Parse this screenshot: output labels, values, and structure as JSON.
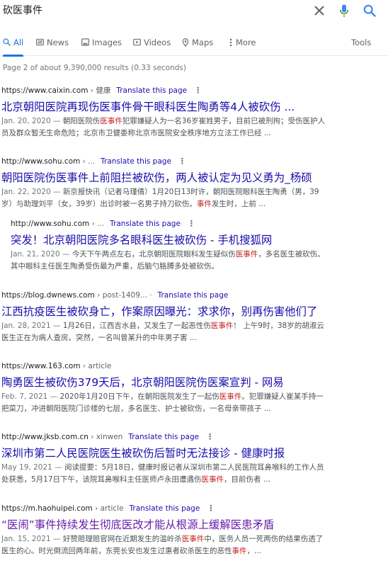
{
  "search": {
    "query": "砍医事件"
  },
  "tabs": [
    {
      "label": "All",
      "icon": "search-icon",
      "active": true
    },
    {
      "label": "News",
      "icon": "news-icon"
    },
    {
      "label": "Images",
      "icon": "image-icon"
    },
    {
      "label": "Videos",
      "icon": "video-icon"
    },
    {
      "label": "Maps",
      "icon": "map-pin-icon"
    },
    {
      "label": "More",
      "icon": "more-vertical-icon"
    }
  ],
  "tools_label": "Tools",
  "stats": "Page 2 of about 9,390,000 results (0.33 seconds)",
  "translate_label": "Translate this page",
  "results": [
    {
      "site": "https://www.caixin.com",
      "path": "健康",
      "title": "北京朝阳医院再现伤医事件骨干眼科医生陶勇等4人被砍伤 ...",
      "date": "Jan. 20, 2020",
      "line1_a": "朝阳医院伤",
      "line1_hl": "医事件",
      "line1_b": "犯罪嫌疑人为一名36岁崔姓男子，目前已被刑拘；受伤医护人",
      "line2": "员及群众暂无生命危险；北京市卫健委称北京市医院安全秩序地方立法工作已经 ..."
    },
    {
      "site": "http://www.sohu.com",
      "path": "...",
      "title": "朝阳医院伤医事件上前阻拦被砍伤，两人被认定为见义勇为_杨硕",
      "date": "Jan. 22, 2020",
      "line1": "新京报快讯（记者马瑾倩）1月20日13时许，朝阳医院眼科医生陶勇（男，39",
      "line2_a": "岁）与助理刘平（女，39岁）出诊时被一名男子持刀砍伤。",
      "line2_hl": "事件",
      "line2_b": "发生时，上前 ..."
    },
    {
      "site": "http://www.sohu.com",
      "path": "...",
      "title": "突发！北京朝阳医院多名眼科医生被砍伤 - 手机搜狐网",
      "date": "Jan. 21, 2020",
      "line1_a": "今天下午两点左右，北京朝阳医院眼科发生疑似伤",
      "line1_hl": "医事件",
      "line1_b": "，多名医生被砍伤。",
      "line2": "其中眼科主任医生陶勇受伤最为严重，后脑勺胳膊多处被砍伤。"
    },
    {
      "site": "https://blog.dwnews.com",
      "path": "post-1409...",
      "title": "江西抗疫医生被砍身亡，作案原因曝光：求求你，别再伤害他们了",
      "date": "Jan. 28, 2021",
      "line1_a": "1月26日，江西吉水县，又发生了一起恶性伤",
      "line1_hl": "医事件",
      "line1_b": "！ 上午9时，38岁的胡淑云",
      "line2": "医生正在为病人查房。突然，一名叫曾某升的中年男子害 ..."
    },
    {
      "site": "https://www.163.com",
      "path": "article",
      "title": "陶勇医生被砍伤379天后，北京朝阳医院伤医案宣判 - 网易",
      "date": "Feb. 7, 2021",
      "line1_a": "2020年1月20日下午，在朝阳医院发生了一起伤",
      "line1_hl": "医事件",
      "line1_b": "。犯罪嫌疑人崔某手持一",
      "line2": "把菜刀，冲进朝阳医院门诊楼的七层，多名医生、护士被砍伤，一名母亲带孩子 ..."
    },
    {
      "site": "http://www.jksb.com.cn",
      "path": "xinwen",
      "title": "深圳市第二人民医院医生被砍伤后暂时无法接诊 - 健康时报",
      "date": "May 19, 2021",
      "line1": "阅读提要：5月18日，健康时报记者从深圳市第二人民医院耳鼻喉科的工作人员",
      "line2_a": "处获悉，5月17日下午，该院耳鼻喉科主任医师卢永田遭遇伤",
      "line2_hl": "医事件",
      "line2_b": "，目前伤者 ..."
    },
    {
      "site": "https://m.haohuipei.com",
      "path": "article",
      "title": "“医闹”事件持续发生彻底医改才能从根源上缓解医患矛盾",
      "date": "Jan. 15, 2021",
      "line1_a": "好赞赔理赔官网在近期发生的温岭杀",
      "line1_hl": "医事件",
      "line1_b": "中，医务人员一死两伤的结果伤透了",
      "line2_a": "医生的心。时光倒流回两年前，东莞长安也发生过惠者砍杀医生的恶性",
      "line2_hl": "事件",
      "line2_b": "，..."
    }
  ]
}
